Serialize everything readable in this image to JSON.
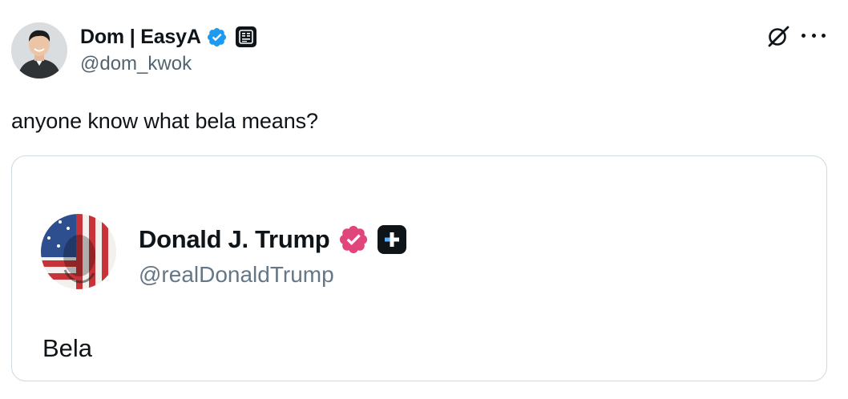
{
  "tweet": {
    "author": {
      "display_name": "Dom | EasyA",
      "handle": "@dom_kwok",
      "verified_icon": "verified-badge-icon",
      "affiliate_icon": "easya-affiliate-icon"
    },
    "text": "anyone know what bela means?",
    "actions": {
      "grok_icon": "grok-icon",
      "more_icon": "more-options-icon"
    }
  },
  "media": {
    "author": {
      "display_name": "Donald J. Trump",
      "handle": "@realDonaldTrump",
      "verified_icon": "verified-badge-icon",
      "plus_icon": "plus-badge-icon"
    },
    "text": "Bela"
  },
  "colors": {
    "text_primary": "#0f1419",
    "text_secondary": "#536471",
    "verified_blue": "#1d9bf0",
    "verified_pink": "#e0457b",
    "card_border": "#cfd9de"
  }
}
